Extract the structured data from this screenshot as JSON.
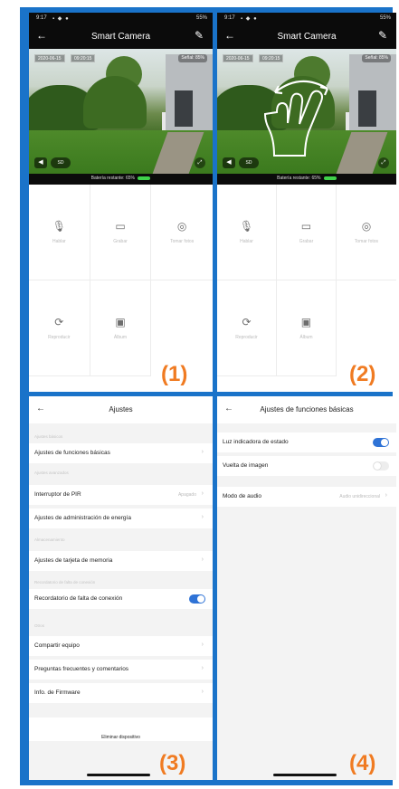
{
  "panel1": {
    "status_time": "9:17",
    "status_right": "55%",
    "title": "Smart Camera",
    "stamp_date": "2020-06-15",
    "stamp_time": "09:20:15",
    "signal": "Señal: 85%",
    "sd_label": "SD",
    "battery": "Batería restante: 65%",
    "controls": [
      "Hablar",
      "Grabar",
      "Tomar fotos",
      "Reproducir",
      "Álbum"
    ],
    "number": "(1)"
  },
  "panel2": {
    "status_time": "9:17",
    "status_right": "55%",
    "title": "Smart Camera",
    "stamp_date": "2020-06-15",
    "stamp_time": "09:20:15",
    "signal": "Señal: 85%",
    "sd_label": "SD",
    "battery": "Batería restante: 65%",
    "controls": [
      "Hablar",
      "Grabar",
      "Tomar fotos",
      "Reproducir",
      "Álbum"
    ],
    "number": "(2)"
  },
  "panel3": {
    "title": "Ajustes",
    "sections": {
      "basic": "Ajustes básicos",
      "advanced": "Ajustes avanzados",
      "storage": "Almacenamiento",
      "offline": "Recordatorio de falta de conexión",
      "other": "Otros"
    },
    "rows": {
      "basic_functions": "Ajustes de funciones básicas",
      "pir": "Interruptor de PIR",
      "pir_value": "Apagado",
      "power": "Ajustes de administración de energía",
      "sd_card": "Ajustes de tarjeta de memoria",
      "offline_reminder": "Recordatorio de falta de conexión",
      "share": "Compartir equipo",
      "faq": "Preguntas frecuentes y comentarios",
      "firmware": "Info. de Firmware"
    },
    "delete": "Eliminar dispositivo",
    "offline_reminder_on": true,
    "number": "(3)"
  },
  "panel4": {
    "title": "Ajustes de funciones básicas",
    "rows": {
      "status_light": "Luz indicadora de estado",
      "flip": "Vuelta de imagen",
      "audio_mode": "Modo de audio",
      "audio_value": "Audio unidireccional"
    },
    "status_light_on": true,
    "flip_on": false,
    "number": "(4)"
  },
  "colors": {
    "frame": "#1a73c9",
    "accent_number": "#f07b22",
    "toggle_on": "#2f73d6",
    "battery": "#3fd24b"
  }
}
